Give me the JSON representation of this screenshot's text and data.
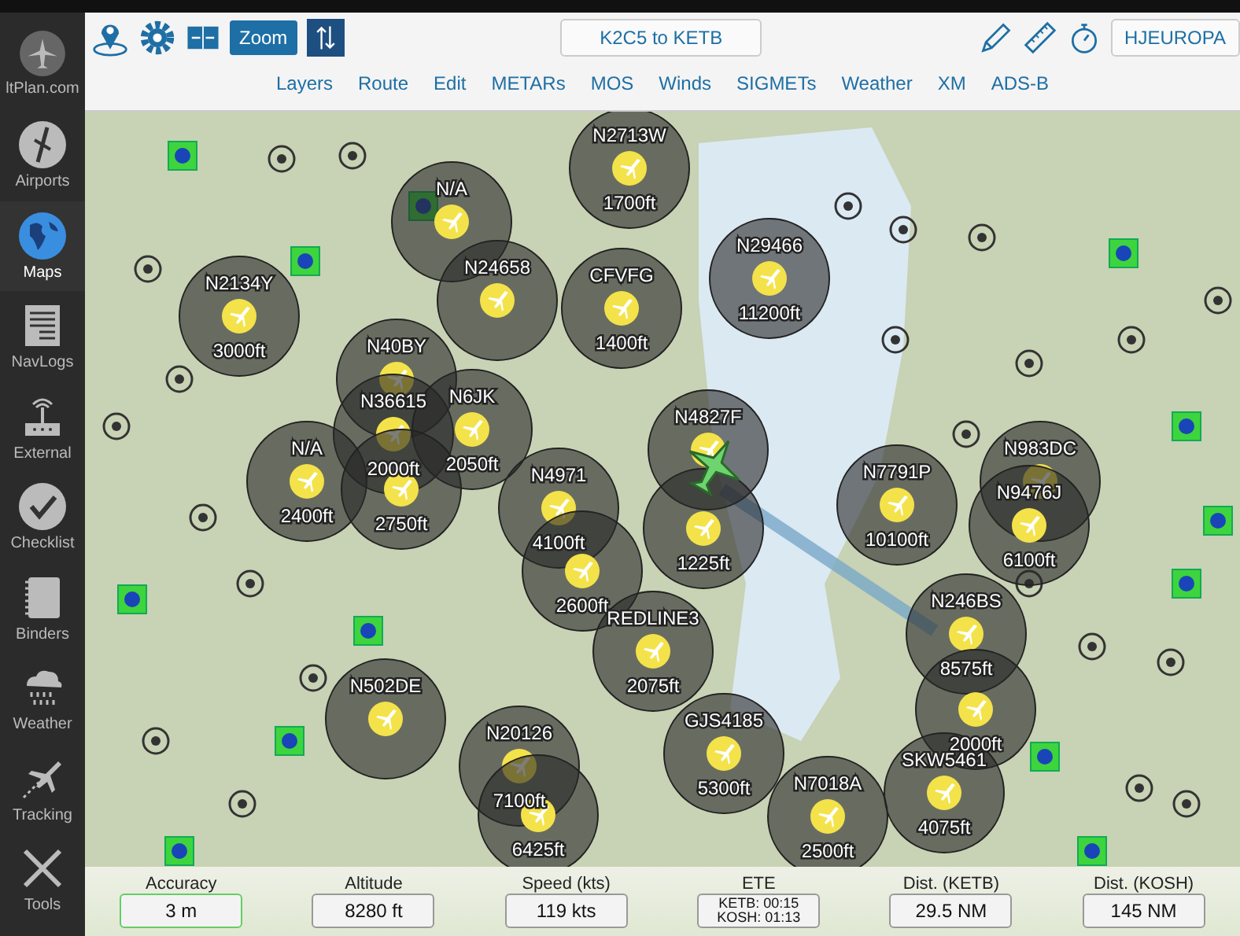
{
  "sidebar": {
    "logo_text": "ltPlan.com",
    "items": [
      {
        "label": "Airports",
        "selected": false
      },
      {
        "label": "Maps",
        "selected": true
      },
      {
        "label": "NavLogs",
        "selected": false
      },
      {
        "label": "External",
        "selected": false
      },
      {
        "label": "Checklist",
        "selected": false
      },
      {
        "label": "Binders",
        "selected": false
      },
      {
        "label": "Weather",
        "selected": false
      },
      {
        "label": "Tracking",
        "selected": false
      },
      {
        "label": "Tools",
        "selected": false
      }
    ]
  },
  "toolbar": {
    "zoom_button": "Zoom",
    "route_button": "K2C5 to KETB",
    "profile_button": "HJEUROPA"
  },
  "menu": [
    "Layers",
    "Route",
    "Edit",
    "METARs",
    "MOS",
    "Winds",
    "SIGMETs",
    "Weather",
    "XM",
    "ADS-B"
  ],
  "traffic": [
    {
      "callsign": "N2713W",
      "altitude": "1700ft"
    },
    {
      "callsign": "N/A"
    },
    {
      "callsign": "N29466",
      "altitude": "11200ft"
    },
    {
      "callsign": "N2134Y",
      "altitude": "3000ft"
    },
    {
      "callsign": "N40BY"
    },
    {
      "callsign": "N24658"
    },
    {
      "callsign": "CFVFG",
      "altitude": "1400ft"
    },
    {
      "callsign": "N36615",
      "altitude": "2000ft"
    },
    {
      "callsign": "N6JK",
      "altitude": "2050ft"
    },
    {
      "callsign": "N4827F"
    },
    {
      "callsign": "N/A",
      "altitude": "2400ft"
    },
    {
      "altitude": "2750ft"
    },
    {
      "callsign": "N983DC"
    },
    {
      "callsign": "N4971",
      "altitude": "4100ft"
    },
    {
      "altitude": "1225ft"
    },
    {
      "callsign": "N7791P",
      "altitude": "10100ft"
    },
    {
      "callsign": "N9476J",
      "altitude": "6100ft"
    },
    {
      "altitude": "2600ft"
    },
    {
      "callsign": "REDLINE3",
      "altitude": "2075ft"
    },
    {
      "callsign": "N246BS",
      "altitude": "8575ft"
    },
    {
      "callsign": "N502DE"
    },
    {
      "altitude": "2000ft"
    },
    {
      "callsign": "N20126",
      "altitude": "7100ft"
    },
    {
      "callsign": "GJS4185",
      "altitude": "5300ft"
    },
    {
      "callsign": "SKW5461",
      "altitude": "4075ft"
    },
    {
      "altitude": "6425ft"
    },
    {
      "callsign": "N7018A",
      "altitude": "2500ft"
    }
  ],
  "readouts": [
    {
      "label": "Accuracy",
      "value": [
        "3 m"
      ],
      "highlighted": true
    },
    {
      "label": "Altitude",
      "value": [
        "8280 ft"
      ],
      "highlighted": false
    },
    {
      "label": "Speed (kts)",
      "value": [
        "119 kts"
      ],
      "highlighted": false
    },
    {
      "label": "ETE",
      "value": [
        "KETB: 00:15",
        "KOSH: 01:13"
      ],
      "highlighted": false
    },
    {
      "label": "Dist. (KETB)",
      "value": [
        "29.5 NM"
      ],
      "highlighted": false
    },
    {
      "label": "Dist. (KOSH)",
      "value": [
        "145 NM"
      ],
      "highlighted": false
    }
  ]
}
